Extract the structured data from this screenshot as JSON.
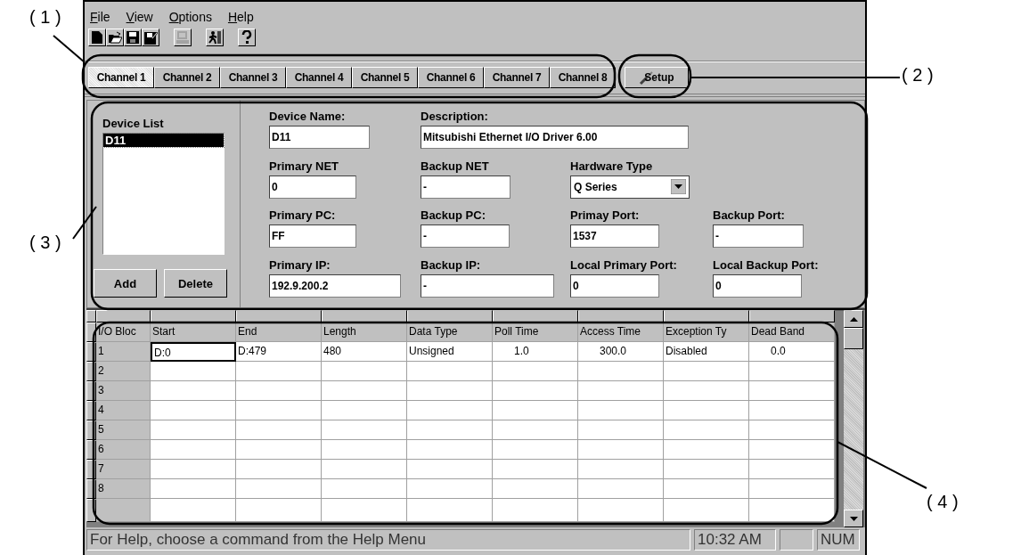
{
  "menu": [
    {
      "label": "File"
    },
    {
      "label": "View"
    },
    {
      "label": "Options"
    },
    {
      "label": "Help"
    }
  ],
  "toolbar": [
    {
      "buttons": [
        {
          "kind": "new",
          "disabled": false
        },
        {
          "kind": "open",
          "disabled": false
        },
        {
          "kind": "save",
          "disabled": false
        },
        {
          "kind": "save_as",
          "disabled": false
        }
      ]
    },
    {
      "buttons": [
        {
          "kind": "computer",
          "disabled": true
        }
      ]
    },
    {
      "buttons": [
        {
          "kind": "exit",
          "disabled": false
        }
      ]
    },
    {
      "buttons": [
        {
          "kind": "help",
          "disabled": false
        }
      ]
    }
  ],
  "tabs": [
    {
      "label": "Channel 1",
      "selected": true
    },
    {
      "label": "Channel 2",
      "selected": false
    },
    {
      "label": "Channel 3",
      "selected": false
    },
    {
      "label": "Channel 4",
      "selected": false
    },
    {
      "label": "Channel 5",
      "selected": false
    },
    {
      "label": "Channel 6",
      "selected": false
    },
    {
      "label": "Channel 7",
      "selected": false
    },
    {
      "label": "Channel 8",
      "selected": false
    }
  ],
  "setup_button": {
    "label": "Setup"
  },
  "device_list": {
    "title": "Device List",
    "items": [
      {
        "label": "D11",
        "selected": true
      }
    ],
    "buttons": [
      "Add",
      "Delete"
    ]
  },
  "fields": [
    [
      {
        "label": "Device Name:",
        "value": "D11",
        "kind": "text"
      },
      {
        "label": "Description:",
        "value": "Mitsubishi Ethernet I/O Driver 6.00",
        "kind": "text"
      }
    ],
    [
      {
        "label": "Primary NET",
        "value": "0",
        "kind": "text"
      },
      {
        "label": "Backup NET",
        "value": "-",
        "kind": "text"
      },
      {
        "label": "Hardware Type",
        "value": "Q Series",
        "kind": "dropdown"
      }
    ],
    [
      {
        "label": "Primary PC:",
        "value": "FF",
        "kind": "text"
      },
      {
        "label": "Backup PC:",
        "value": "-",
        "kind": "text"
      },
      {
        "label": "Primay Port:",
        "value": "1537",
        "kind": "text"
      },
      {
        "label": "Backup Port:",
        "value": "-",
        "kind": "text"
      }
    ],
    [
      {
        "label": "Primary IP:",
        "value": "192.9.200.2",
        "kind": "text"
      },
      {
        "label": "Backup IP:",
        "value": "-",
        "kind": "text"
      },
      {
        "label": "Local Primary Port:",
        "value": "0",
        "kind": "text"
      },
      {
        "label": "Local Backup Port:",
        "value": "0",
        "kind": "text"
      }
    ]
  ],
  "grid": {
    "columns": [
      "I/O Bloc",
      "Start",
      "End",
      "Length",
      "Data Type",
      "Poll Time",
      "Access Time",
      "Exception Ty",
      "Dead Band"
    ],
    "rows": [
      {
        "label": "1",
        "cells": [
          {
            "text": "D:0",
            "kind": "text",
            "selected": true
          },
          {
            "text": "D:479",
            "kind": "text",
            "selected": false
          },
          {
            "text": "480",
            "kind": "text",
            "selected": false
          },
          {
            "text": "Unsigned",
            "kind": "text",
            "selected": false
          },
          {
            "text": "1.0",
            "kind": "number",
            "selected": false
          },
          {
            "text": "300.0",
            "kind": "number",
            "selected": false
          },
          {
            "text": "Disabled",
            "kind": "text",
            "selected": false
          },
          {
            "text": "0.0",
            "kind": "number",
            "selected": false
          }
        ]
      },
      {
        "label": "2"
      },
      {
        "label": "3"
      },
      {
        "label": "4"
      },
      {
        "label": "5"
      },
      {
        "label": "6"
      },
      {
        "label": "7"
      },
      {
        "label": "8"
      }
    ]
  },
  "status_bar": {
    "message": "For Help, choose a command from the Help Menu",
    "time": "10:32 AM",
    "indicator": "NUM"
  },
  "callouts": [
    {
      "label": "( 1 )"
    },
    {
      "label": "( 2 )"
    },
    {
      "label": "( 3 )"
    },
    {
      "label": "( 4 )"
    }
  ]
}
